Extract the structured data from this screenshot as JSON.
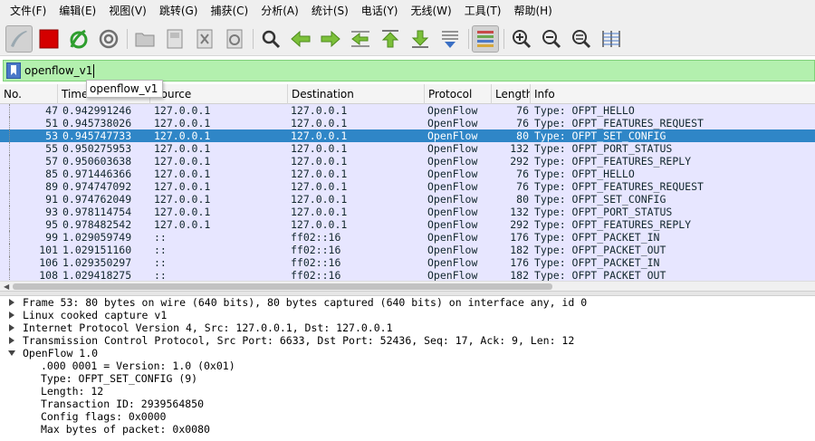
{
  "menu": [
    "文件(F)",
    "编辑(E)",
    "视图(V)",
    "跳转(G)",
    "捕获(C)",
    "分析(A)",
    "统计(S)",
    "电话(Y)",
    "无线(W)",
    "工具(T)",
    "帮助(H)"
  ],
  "toolbar_icons": [
    "start-capture-icon",
    "stop-capture-icon",
    "restart-capture-icon",
    "capture-options-icon",
    "open-file-icon",
    "save-file-icon",
    "close-file-icon",
    "reload-file-icon",
    "find-packet-icon",
    "go-back-icon",
    "go-forward-icon",
    "go-to-packet-icon",
    "go-first-icon",
    "go-last-icon",
    "auto-scroll-icon",
    "colorize-icon",
    "zoom-in-icon",
    "zoom-out-icon",
    "normal-size-icon",
    "resize-columns-icon"
  ],
  "filter": {
    "value": "openflow_v1",
    "suggestion": "openflow_v1"
  },
  "columns": [
    "No.",
    "Time",
    "Source",
    "Destination",
    "Protocol",
    "Length",
    "Info"
  ],
  "packets": [
    {
      "no": "47",
      "time": "0.942991246",
      "src": "127.0.0.1",
      "dst": "127.0.0.1",
      "proto": "OpenFlow",
      "len": "76",
      "info": "Type: OFPT_HELLO"
    },
    {
      "no": "51",
      "time": "0.945738026",
      "src": "127.0.0.1",
      "dst": "127.0.0.1",
      "proto": "OpenFlow",
      "len": "76",
      "info": "Type: OFPT_FEATURES_REQUEST"
    },
    {
      "no": "53",
      "time": "0.945747733",
      "src": "127.0.0.1",
      "dst": "127.0.0.1",
      "proto": "OpenFlow",
      "len": "80",
      "info": "Type: OFPT_SET_CONFIG",
      "selected": true
    },
    {
      "no": "55",
      "time": "0.950275953",
      "src": "127.0.0.1",
      "dst": "127.0.0.1",
      "proto": "OpenFlow",
      "len": "132",
      "info": "Type: OFPT_PORT_STATUS"
    },
    {
      "no": "57",
      "time": "0.950603638",
      "src": "127.0.0.1",
      "dst": "127.0.0.1",
      "proto": "OpenFlow",
      "len": "292",
      "info": "Type: OFPT_FEATURES_REPLY"
    },
    {
      "no": "85",
      "time": "0.971446366",
      "src": "127.0.0.1",
      "dst": "127.0.0.1",
      "proto": "OpenFlow",
      "len": "76",
      "info": "Type: OFPT_HELLO"
    },
    {
      "no": "89",
      "time": "0.974747092",
      "src": "127.0.0.1",
      "dst": "127.0.0.1",
      "proto": "OpenFlow",
      "len": "76",
      "info": "Type: OFPT_FEATURES_REQUEST"
    },
    {
      "no": "91",
      "time": "0.974762049",
      "src": "127.0.0.1",
      "dst": "127.0.0.1",
      "proto": "OpenFlow",
      "len": "80",
      "info": "Type: OFPT_SET_CONFIG"
    },
    {
      "no": "93",
      "time": "0.978114754",
      "src": "127.0.0.1",
      "dst": "127.0.0.1",
      "proto": "OpenFlow",
      "len": "132",
      "info": "Type: OFPT_PORT_STATUS"
    },
    {
      "no": "95",
      "time": "0.978482542",
      "src": "127.0.0.1",
      "dst": "127.0.0.1",
      "proto": "OpenFlow",
      "len": "292",
      "info": "Type: OFPT_FEATURES_REPLY"
    },
    {
      "no": "99",
      "time": "1.029059749",
      "src": "::",
      "dst": "ff02::16",
      "proto": "OpenFlow",
      "len": "176",
      "info": "Type: OFPT_PACKET_IN"
    },
    {
      "no": "101",
      "time": "1.029151160",
      "src": "::",
      "dst": "ff02::16",
      "proto": "OpenFlow",
      "len": "182",
      "info": "Type: OFPT_PACKET_OUT"
    },
    {
      "no": "106",
      "time": "1.029350297",
      "src": "::",
      "dst": "ff02::16",
      "proto": "OpenFlow",
      "len": "176",
      "info": "Type: OFPT_PACKET_IN"
    },
    {
      "no": "108",
      "time": "1.029418275",
      "src": "::",
      "dst": "ff02::16",
      "proto": "OpenFlow",
      "len": "182",
      "info": "Type: OFPT_PACKET_OUT"
    }
  ],
  "details": [
    {
      "text": "Frame 53: 80 bytes on wire (640 bits), 80 bytes captured (640 bits) on interface any, id 0",
      "expander": "collapsed"
    },
    {
      "text": "Linux cooked capture v1",
      "expander": "collapsed"
    },
    {
      "text": "Internet Protocol Version 4, Src: 127.0.0.1, Dst: 127.0.0.1",
      "expander": "collapsed"
    },
    {
      "text": "Transmission Control Protocol, Src Port: 6633, Dst Port: 52436, Seq: 17, Ack: 9, Len: 12",
      "expander": "collapsed"
    },
    {
      "text": "OpenFlow 1.0",
      "expander": "expanded"
    },
    {
      "text": ".000 0001 = Version: 1.0 (0x01)",
      "child": true
    },
    {
      "text": "Type: OFPT_SET_CONFIG (9)",
      "child": true
    },
    {
      "text": "Length: 12",
      "child": true
    },
    {
      "text": "Transaction ID: 2939564850",
      "child": true
    },
    {
      "text": "Config flags: 0x0000",
      "child": true
    },
    {
      "text": "Max bytes of packet: 0x0080",
      "child": true
    }
  ],
  "colors": {
    "filter_valid_bg": "#b3f0ae",
    "row_bg": "#e7e6ff",
    "row_text": "#12272e",
    "selected_bg": "#2f86c7"
  }
}
